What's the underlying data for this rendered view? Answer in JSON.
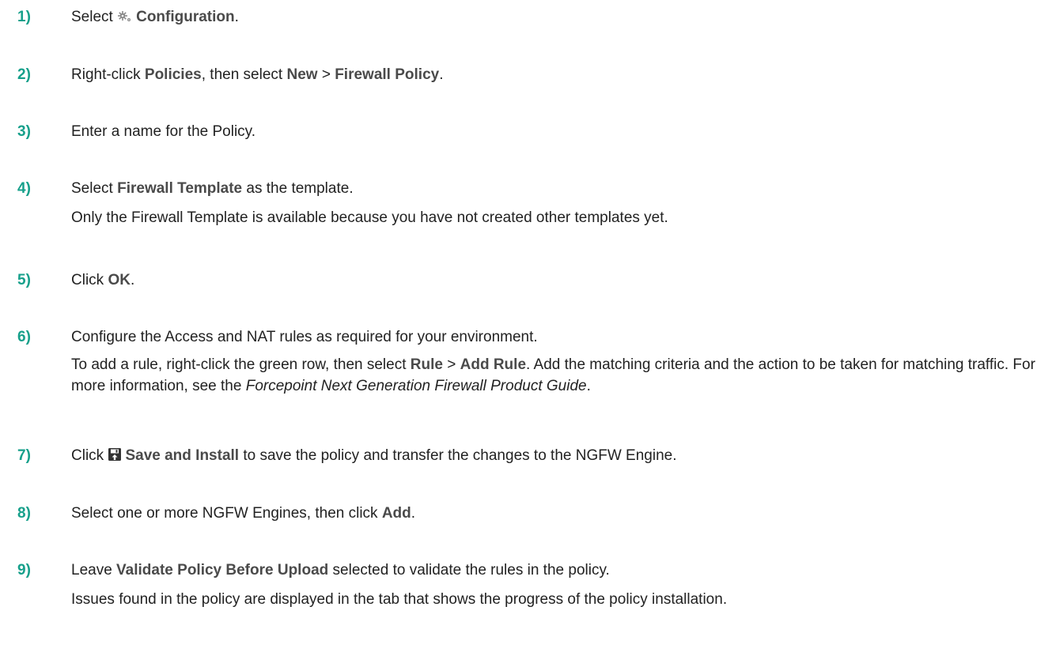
{
  "steps": [
    {
      "number": "1)",
      "lines": [
        [
          {
            "text": "Select "
          },
          {
            "icon": "gear-icon"
          },
          {
            "text": "Configuration",
            "bold": true
          },
          {
            "text": "."
          }
        ]
      ]
    },
    {
      "number": "2)",
      "lines": [
        [
          {
            "text": "Right-click "
          },
          {
            "text": "Policies",
            "bold": true
          },
          {
            "text": ", then select "
          },
          {
            "text": "New",
            "bold": true
          },
          {
            "text": " > "
          },
          {
            "text": "Firewall Policy",
            "bold": true
          },
          {
            "text": "."
          }
        ]
      ]
    },
    {
      "number": "3)",
      "lines": [
        [
          {
            "text": "Enter a name for the Policy."
          }
        ]
      ]
    },
    {
      "number": "4)",
      "lines": [
        [
          {
            "text": "Select "
          },
          {
            "text": "Firewall Template",
            "bold": true
          },
          {
            "text": " as the template."
          }
        ],
        [
          {
            "text": "Only the Firewall Template is available because you have not created other templates yet."
          }
        ]
      ]
    },
    {
      "number": "5)",
      "lines": [
        [
          {
            "text": "Click "
          },
          {
            "text": "OK",
            "bold": true
          },
          {
            "text": "."
          }
        ]
      ]
    },
    {
      "number": "6)",
      "lines": [
        [
          {
            "text": "Configure the Access and NAT rules as required for your environment."
          }
        ],
        [
          {
            "text": "To add a rule, right-click the green row, then select "
          },
          {
            "text": "Rule",
            "bold": true
          },
          {
            "text": " > "
          },
          {
            "text": "Add Rule",
            "bold": true
          },
          {
            "text": ". Add the matching criteria and the action to be taken for matching traffic. For more information, see the "
          },
          {
            "text": "Forcepoint Next Generation Firewall Product Guide",
            "italic": true
          },
          {
            "text": "."
          }
        ]
      ]
    },
    {
      "number": "7)",
      "lines": [
        [
          {
            "text": "Click "
          },
          {
            "icon": "save-install-icon"
          },
          {
            "text": "Save and Install",
            "bold": true
          },
          {
            "text": " to save the policy and transfer the changes to the NGFW Engine."
          }
        ]
      ]
    },
    {
      "number": "8)",
      "lines": [
        [
          {
            "text": "Select one or more NGFW Engines, then click "
          },
          {
            "text": "Add",
            "bold": true
          },
          {
            "text": "."
          }
        ]
      ]
    },
    {
      "number": "9)",
      "lines": [
        [
          {
            "text": "Leave "
          },
          {
            "text": "Validate Policy Before Upload",
            "bold": true
          },
          {
            "text": " selected to validate the rules in the policy."
          }
        ],
        [
          {
            "text": "Issues found in the policy are displayed in the tab that shows the progress of the policy installation."
          }
        ]
      ]
    }
  ]
}
